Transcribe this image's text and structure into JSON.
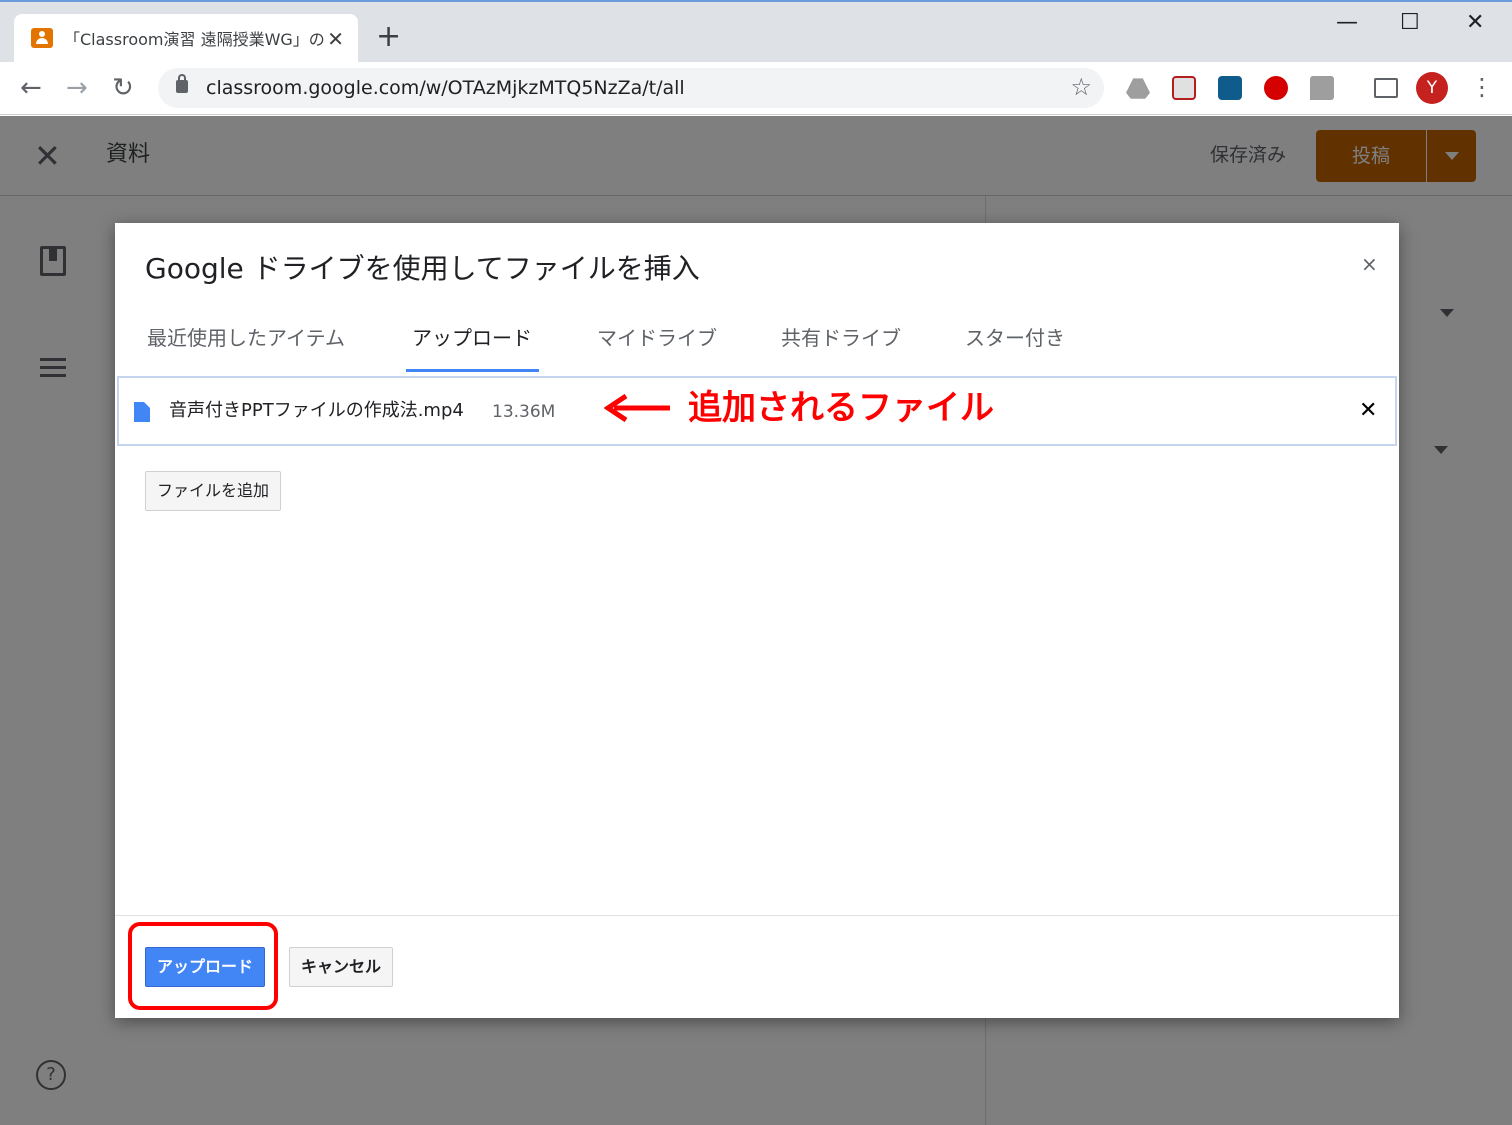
{
  "browser": {
    "tab_title": "「Classroom演習 遠隔授業WG」の資料",
    "tab_close": "✕",
    "new_tab": "+",
    "window_controls": {
      "minimize": "—",
      "maximize": "☐",
      "close": "✕"
    },
    "nav": {
      "back": "←",
      "forward": "→",
      "reload": "↻"
    },
    "url": "classroom.google.com/w/OTAzMjkzMTQ5NzZa/t/all",
    "star": "☆",
    "avatar_letter": "Y",
    "menu": "⋮"
  },
  "page": {
    "close": "✕",
    "title": "資料",
    "saved_label": "保存済み",
    "post_label": "投稿",
    "help": "?"
  },
  "dialog": {
    "title": "Google ドライブを使用してファイルを挿入",
    "close": "×",
    "tabs": [
      {
        "label": "最近使用したアイテム"
      },
      {
        "label": "アップロード"
      },
      {
        "label": "マイドライブ"
      },
      {
        "label": "共有ドライブ"
      },
      {
        "label": "スター付き"
      }
    ],
    "active_tab": "アップロード",
    "file": {
      "name": "音声付きPPTファイルの作成法.mp4",
      "size": "13.36M",
      "remove": "✕"
    },
    "add_file_label": "ファイルを追加",
    "upload_label": "アップロード",
    "cancel_label": "キャンセル"
  },
  "annotations": {
    "arrow_label": "追加されるファイル",
    "color": "#ff0000"
  },
  "colors": {
    "accent_blue": "#4285f4",
    "post_button": "#c26401",
    "avatar": "#c5221f"
  }
}
